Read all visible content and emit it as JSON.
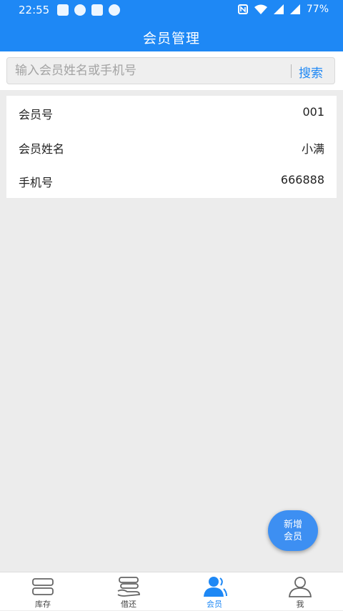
{
  "status_bar": {
    "time": "22:55",
    "battery": "77%"
  },
  "app_bar": {
    "title": "会员管理"
  },
  "search": {
    "placeholder": "输入会员姓名或手机号",
    "value": "",
    "button_label": "搜索"
  },
  "member": {
    "rows": [
      {
        "label": "会员号",
        "value": "001"
      },
      {
        "label": "会员姓名",
        "value": "小满"
      },
      {
        "label": "手机号",
        "value": "666888"
      }
    ]
  },
  "fab": {
    "line1": "新增",
    "line2": "会员"
  },
  "tabs": [
    {
      "label": "库存",
      "icon": "inventory-icon"
    },
    {
      "label": "借还",
      "icon": "borrow-return-icon"
    },
    {
      "label": "会员",
      "icon": "members-icon",
      "active": true
    },
    {
      "label": "我",
      "icon": "profile-icon"
    }
  ],
  "colors": {
    "primary": "#1e88f5",
    "background": "#ececec",
    "fab": "#3d8ff2"
  }
}
